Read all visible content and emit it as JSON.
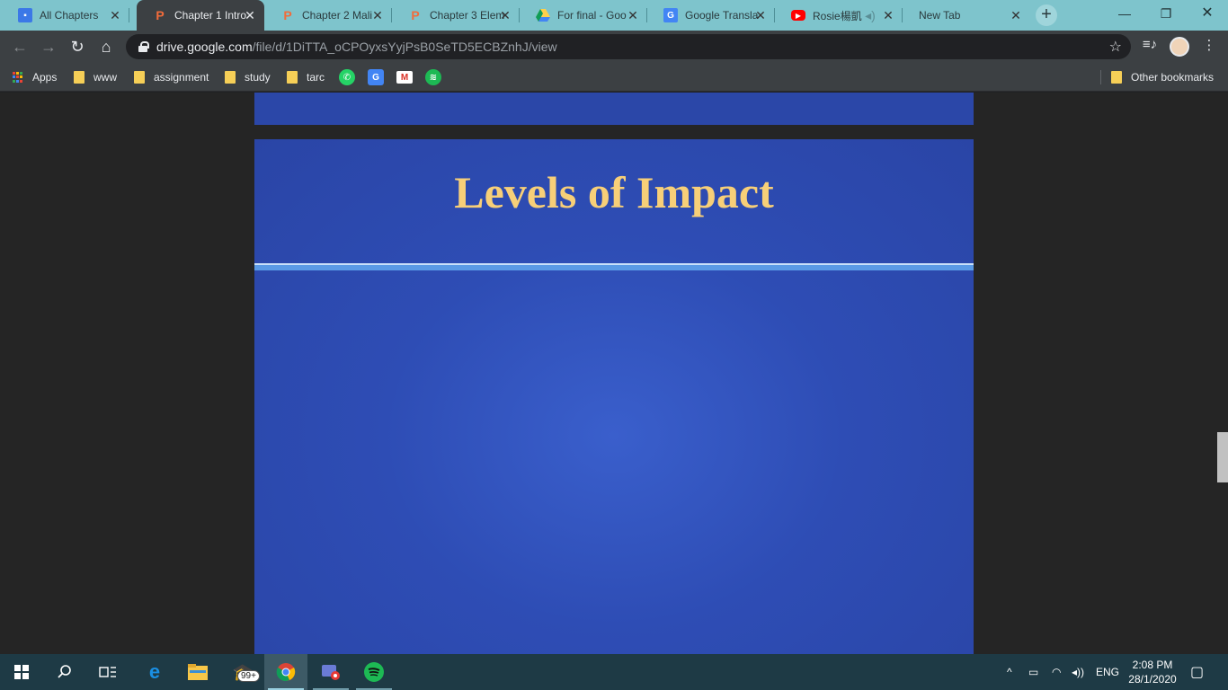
{
  "tabs": [
    {
      "title": "All Chapters",
      "icon": "google-sites-icon",
      "active": false
    },
    {
      "title": "Chapter 1 Intro",
      "icon": "powerpoint-icon",
      "active": true
    },
    {
      "title": "Chapter 2 Mali",
      "icon": "powerpoint-icon",
      "active": false
    },
    {
      "title": "Chapter 3 Elem",
      "icon": "powerpoint-icon",
      "active": false
    },
    {
      "title": "For final - Goo",
      "icon": "google-drive-icon",
      "active": false
    },
    {
      "title": "Google Transla",
      "icon": "google-translate-icon",
      "active": false
    },
    {
      "title": "Rosie楊凱",
      "icon": "youtube-icon",
      "active": false
    },
    {
      "title": "New Tab",
      "icon": "",
      "active": false
    }
  ],
  "address_bar": {
    "host": "drive.google.com",
    "path": "/file/d/1DiTTA_oCPOyxsYyjPsB0SeTD5ECBZnhJ/view"
  },
  "bookmarks": {
    "apps_label": "Apps",
    "folders": [
      "www",
      "assignment",
      "study",
      "tarc"
    ],
    "icons": [
      "whatsapp-icon",
      "google-translate-icon",
      "gmail-icon",
      "spotify-icon"
    ],
    "other_label": "Other bookmarks"
  },
  "slide": {
    "title": "Levels of Impact"
  },
  "taskbar": {
    "notification_badge": "99+",
    "language": "ENG",
    "time": "2:08 PM",
    "date": "28/1/2020"
  },
  "colors": {
    "slide_background": "#2e4db5",
    "slide_title": "#f7cf78",
    "tabstrip": "#7ec4cc",
    "toolbar": "#3c4043"
  }
}
